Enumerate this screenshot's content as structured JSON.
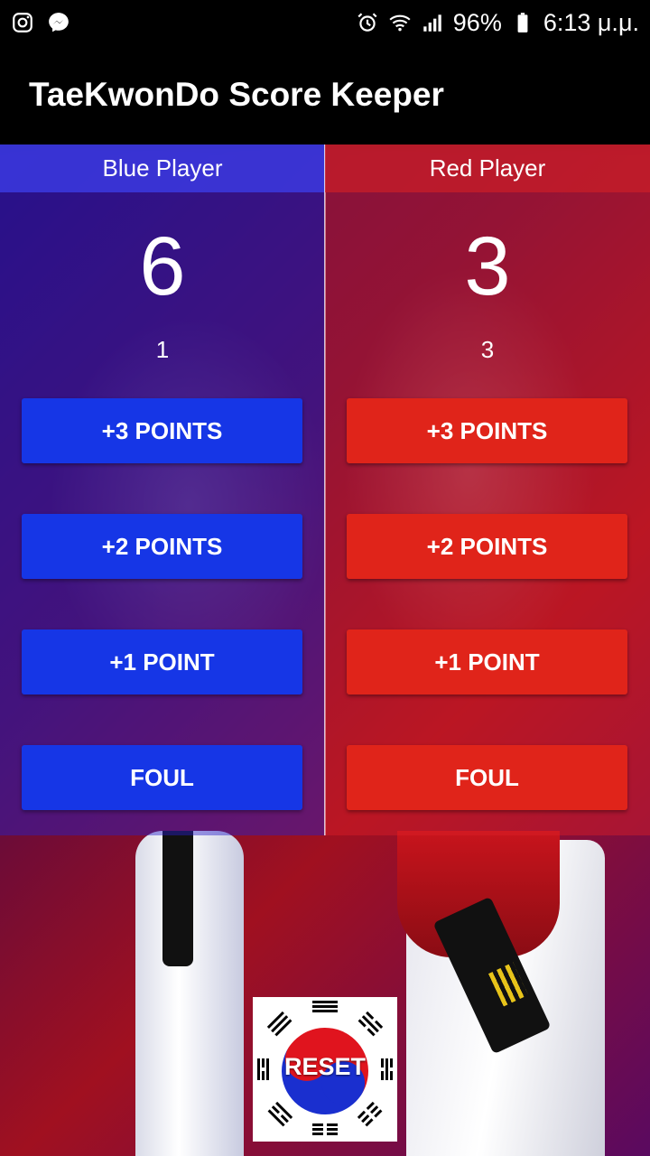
{
  "status_bar": {
    "battery": "96%",
    "time": "6:13 μ.μ.",
    "icons": [
      "instagram-icon",
      "messenger-icon",
      "alarm-icon",
      "wifi-icon",
      "signal-icon",
      "battery-icon"
    ]
  },
  "app_bar": {
    "title": "TaeKwonDo Score Keeper"
  },
  "blue": {
    "name": "Blue Player",
    "score": "6",
    "fouls": "1",
    "btn_3": "+3 POINTS",
    "btn_2": "+2 POINTS",
    "btn_1": "+1 POINT",
    "btn_foul": "FOUL",
    "color": "#1636e6"
  },
  "red": {
    "name": "Red Player",
    "score": "3",
    "fouls": "3",
    "btn_3": "+3 POINTS",
    "btn_2": "+2 POINTS",
    "btn_1": "+1 POINT",
    "btn_foul": "FOUL",
    "color": "#e0241a"
  },
  "reset": {
    "label": "RESET",
    "icon": "korean-flag-icon"
  }
}
